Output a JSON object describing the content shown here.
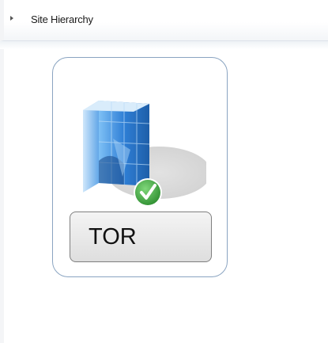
{
  "breadcrumb": {
    "label": "Site Hierarchy"
  },
  "site": {
    "code": "TOR",
    "status": "ok",
    "icon": "server-icon",
    "status_icon": "check-icon",
    "accent_color": "#2f7fd6",
    "status_color": "#3a9b3a"
  }
}
